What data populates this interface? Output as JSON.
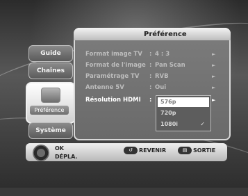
{
  "panel": {
    "title": "Préférence"
  },
  "tabs": {
    "guide": "Guide",
    "chaines": "Chaînes",
    "preference": "Préférence",
    "systeme": "Système"
  },
  "rows": [
    {
      "label": "Format image TV",
      "sep": ":",
      "value": "4 : 3",
      "arrow": "►"
    },
    {
      "label": "Format de l'image",
      "sep": ":",
      "value": "Pan Scan",
      "arrow": "►"
    },
    {
      "label": "Paramétrage TV",
      "sep": ":",
      "value": "RVB",
      "arrow": "►"
    },
    {
      "label": "Antenne 5V",
      "sep": ":",
      "value": "Oui",
      "arrow": "►"
    },
    {
      "label": "Résolution HDMI",
      "sep": ":",
      "value": "",
      "arrow": "►"
    }
  ],
  "dropdown": {
    "options": [
      "576p",
      "720p",
      "1080i"
    ],
    "check": "✓"
  },
  "bottom": {
    "ok": "OK",
    "depla": "DÉPLA.",
    "revenir": "REVENIR",
    "sortie": "SORTIE"
  }
}
